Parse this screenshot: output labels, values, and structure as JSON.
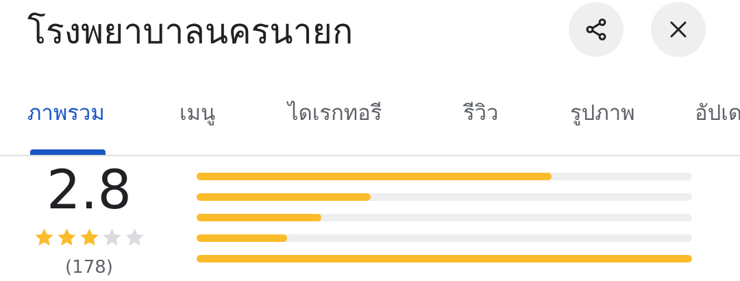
{
  "header": {
    "title": "โรงพยาบาลนครนายก",
    "share_icon": "share-icon",
    "close_icon": "close-icon"
  },
  "tabs": [
    {
      "label": "ภาพรวม",
      "active": true
    },
    {
      "label": "เมนู",
      "active": false
    },
    {
      "label": "ไดเรกทอรี",
      "active": false
    },
    {
      "label": "รีวิว",
      "active": false
    },
    {
      "label": "รูปภาพ",
      "active": false
    },
    {
      "label": "อัปเด",
      "active": false
    }
  ],
  "rating": {
    "average": "2.8",
    "review_count": "(178)",
    "stars_filled": 3,
    "stars_total": 5,
    "distribution": [
      {
        "stars": 5,
        "fraction": 0.717
      },
      {
        "stars": 4,
        "fraction": 0.352
      },
      {
        "stars": 3,
        "fraction": 0.252
      },
      {
        "stars": 2,
        "fraction": 0.182
      },
      {
        "stars": 1,
        "fraction": 1.0
      }
    ]
  },
  "colors": {
    "accent": "#1a56c4",
    "star": "#fbbc2c",
    "star_empty": "#dadce0",
    "bar_track": "#eeeeee"
  }
}
